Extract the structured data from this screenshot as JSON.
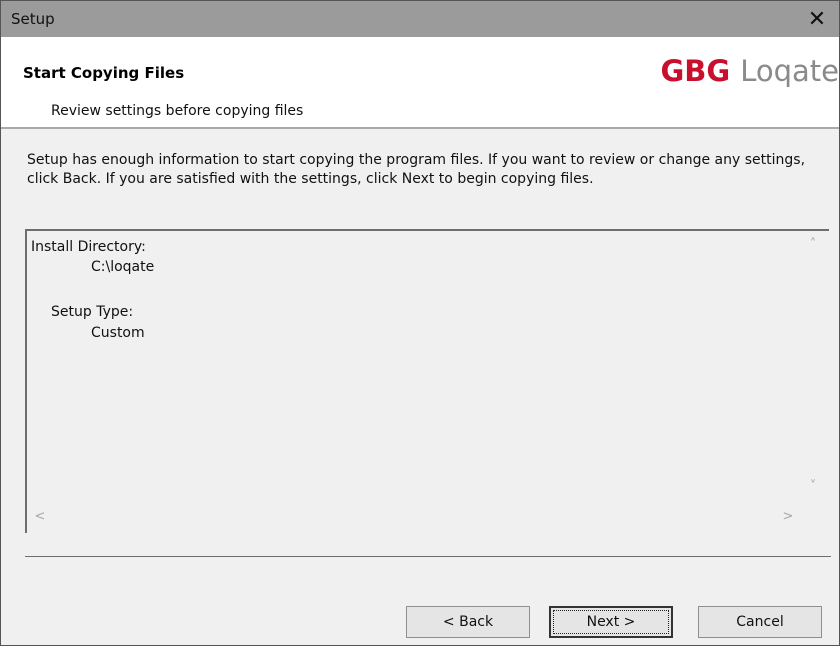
{
  "window": {
    "title": "Setup",
    "close_glyph": "✕"
  },
  "header": {
    "heading": "Start Copying Files",
    "subheading": "Review settings before copying files",
    "logo": {
      "primary": "GBG",
      "secondary": "Loqate",
      "primary_color": "#c8102e",
      "secondary_color": "#8a8a8a"
    }
  },
  "intro": {
    "text": "Setup has enough information to start copying the program files.  If you want to review or change any settings, click Back.  If you are satisfied with the settings, click Next to begin copying files."
  },
  "summary": {
    "install_directory_label": "Install Directory:",
    "install_directory_value": "C:\\loqate",
    "setup_type_label": "Setup Type:",
    "setup_type_value": "Custom"
  },
  "scroll": {
    "up": "˄",
    "down": "˅",
    "left": "<",
    "right": ">"
  },
  "buttons": {
    "back": "< Back",
    "next": "Next >",
    "cancel": "Cancel"
  }
}
